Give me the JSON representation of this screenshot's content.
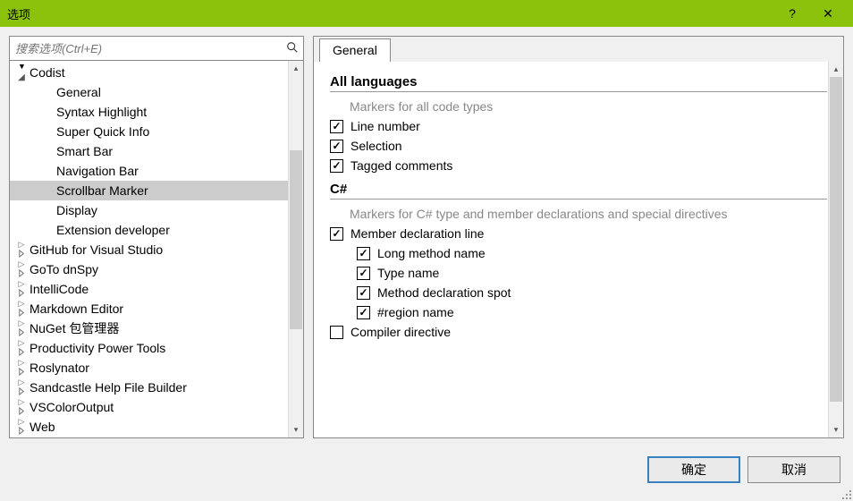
{
  "window": {
    "title": "选项"
  },
  "search": {
    "placeholder": "搜索选项(Ctrl+E)"
  },
  "sidebar": {
    "items": [
      {
        "label": "Codist",
        "indent": 0,
        "toggle": "expanded"
      },
      {
        "label": "General",
        "indent": 1,
        "toggle": "none"
      },
      {
        "label": "Syntax Highlight",
        "indent": 1,
        "toggle": "none"
      },
      {
        "label": "Super Quick Info",
        "indent": 1,
        "toggle": "none"
      },
      {
        "label": "Smart Bar",
        "indent": 1,
        "toggle": "none"
      },
      {
        "label": "Navigation Bar",
        "indent": 1,
        "toggle": "none"
      },
      {
        "label": "Scrollbar Marker",
        "indent": 1,
        "toggle": "none",
        "selected": true
      },
      {
        "label": "Display",
        "indent": 1,
        "toggle": "none"
      },
      {
        "label": "Extension developer",
        "indent": 1,
        "toggle": "none"
      },
      {
        "label": "GitHub for Visual Studio",
        "indent": 0,
        "toggle": "collapsed"
      },
      {
        "label": "GoTo dnSpy",
        "indent": 0,
        "toggle": "collapsed"
      },
      {
        "label": "IntelliCode",
        "indent": 0,
        "toggle": "collapsed"
      },
      {
        "label": "Markdown Editor",
        "indent": 0,
        "toggle": "collapsed"
      },
      {
        "label": "NuGet 包管理器",
        "indent": 0,
        "toggle": "collapsed"
      },
      {
        "label": "Productivity Power Tools",
        "indent": 0,
        "toggle": "collapsed"
      },
      {
        "label": "Roslynator",
        "indent": 0,
        "toggle": "collapsed"
      },
      {
        "label": "Sandcastle Help File Builder",
        "indent": 0,
        "toggle": "collapsed"
      },
      {
        "label": "VSColorOutput",
        "indent": 0,
        "toggle": "collapsed"
      },
      {
        "label": "Web",
        "indent": 0,
        "toggle": "collapsed"
      }
    ]
  },
  "tab": {
    "label": "General"
  },
  "sections": {
    "all": {
      "title": "All languages",
      "desc": "Markers for all code types",
      "items": [
        {
          "label": "Line number",
          "checked": true
        },
        {
          "label": "Selection",
          "checked": true
        },
        {
          "label": "Tagged comments",
          "checked": true
        }
      ]
    },
    "csharp": {
      "title": "C#",
      "desc": "Markers for C# type and member declarations and special directives",
      "items": [
        {
          "label": "Member declaration line",
          "checked": true
        },
        {
          "label": "Long method name",
          "checked": true,
          "indent": 2
        },
        {
          "label": "Type name",
          "checked": true,
          "indent": 2
        },
        {
          "label": "Method declaration spot",
          "checked": true,
          "indent": 2
        },
        {
          "label": "#region name",
          "checked": true,
          "indent": 2
        },
        {
          "label": "Compiler directive",
          "checked": false
        }
      ]
    }
  },
  "buttons": {
    "ok": "确定",
    "cancel": "取消"
  }
}
